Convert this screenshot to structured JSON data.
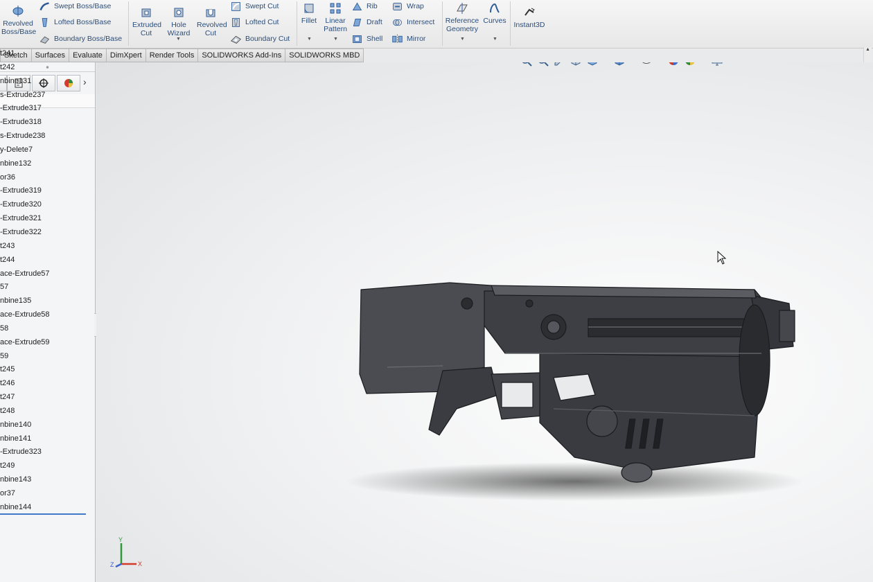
{
  "ribbon": {
    "revolved_boss": "Revolved Boss/Base",
    "swept_boss": "Swept Boss/Base",
    "lofted_boss": "Lofted Boss/Base",
    "boundary_boss": "Boundary Boss/Base",
    "extruded_cut": "Extruded Cut",
    "hole_wizard": "Hole Wizard",
    "revolved_cut": "Revolved Cut",
    "swept_cut": "Swept Cut",
    "lofted_cut": "Lofted Cut",
    "boundary_cut": "Boundary Cut",
    "fillet": "Fillet",
    "linear_pattern": "Linear Pattern",
    "rib": "Rib",
    "draft": "Draft",
    "shell": "Shell",
    "wrap": "Wrap",
    "intersect": "Intersect",
    "mirror": "Mirror",
    "reference_geometry": "Reference Geometry",
    "curves": "Curves",
    "instant3d": "Instant3D"
  },
  "tabs": [
    "Sketch",
    "Surfaces",
    "Evaluate",
    "DimXpert",
    "Render Tools",
    "SOLIDWORKS Add-Ins",
    "SOLIDWORKS MBD"
  ],
  "feature_tree": [
    "t241",
    "t242",
    "nbine131",
    "s-Extrude237",
    "-Extrude317",
    "-Extrude318",
    "s-Extrude238",
    "y-Delete7",
    "nbine132",
    "or36",
    "-Extrude319",
    "-Extrude320",
    "-Extrude321",
    "-Extrude322",
    "t243",
    "t244",
    "ace-Extrude57",
    "57",
    "nbine135",
    "ace-Extrude58",
    "58",
    "ace-Extrude59",
    "59",
    "t245",
    "t246",
    "t247",
    "t248",
    "nbine140",
    "nbine141",
    "-Extrude323",
    "t249",
    "nbine143",
    "or37",
    "nbine144"
  ],
  "triad": {
    "y": "Y",
    "x": "X",
    "z": "Z"
  },
  "colors": {
    "accent": "#2a4d7a",
    "selection": "#3f78c7",
    "model": "#3d3f45"
  }
}
